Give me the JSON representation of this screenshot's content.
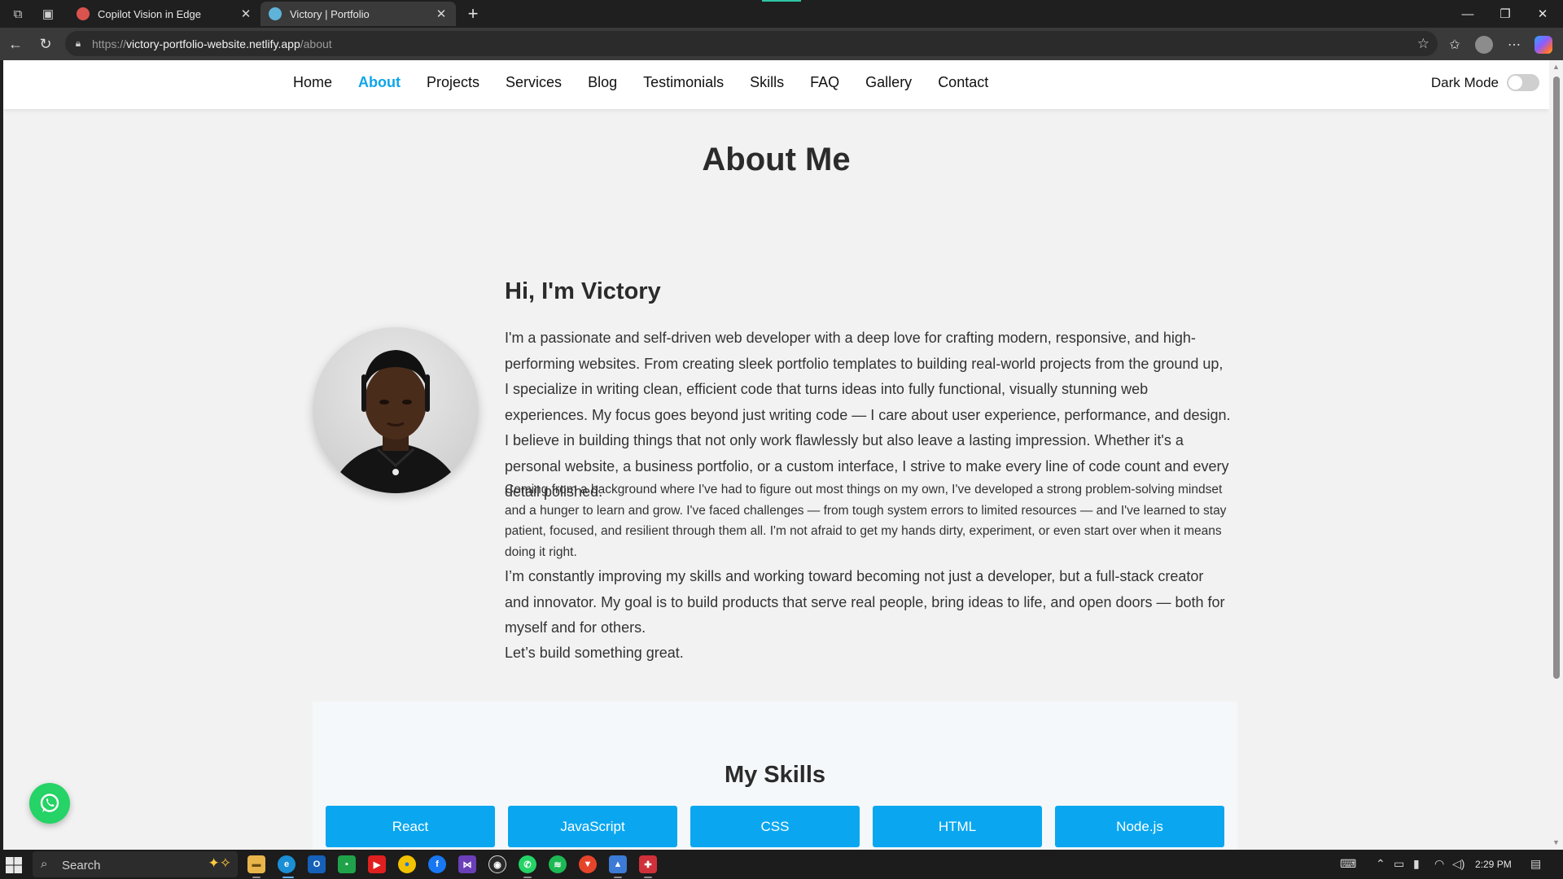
{
  "browser": {
    "tabs": [
      {
        "title": "Copilot Vision in Edge",
        "favicon_color": "#d9534f"
      },
      {
        "title": "Victory | Portfolio",
        "favicon_color": "#5fb3d9"
      }
    ],
    "url_prefix": "https://",
    "url_host": "victory-portfolio-website.netlify.app",
    "url_path": "/about"
  },
  "navbar": {
    "links": [
      "Home",
      "About",
      "Projects",
      "Services",
      "Blog",
      "Testimonials",
      "Skills",
      "FAQ",
      "Gallery",
      "Contact"
    ],
    "active": "About",
    "dark_mode_label": "Dark Mode",
    "dark_mode_on": false,
    "accent_color": "#0ea5ea"
  },
  "about": {
    "title": "About Me",
    "heading": "Hi, I'm Victory",
    "paragraphs": [
      "I'm a passionate and self-driven web developer with a deep love for crafting modern, responsive, and high-performing websites. From creating sleek portfolio templates to building real-world projects from the ground up, I specialize in writing clean, efficient code that turns ideas into fully functional, visually stunning web experiences. My focus goes beyond just writing code — I care about user experience, performance, and design. I believe in building things that not only work flawlessly but also leave a lasting impression. Whether it's a personal website, a business portfolio, or a custom interface, I strive to make every line of code count and every detail polished.",
      "Coming from a background where I've had to figure out most things on my own, I've developed a strong problem-solving mindset and a hunger to learn and grow. I've faced challenges — from tough system errors to limited resources — and I've learned to stay patient, focused, and resilient through them all. I'm not afraid to get my hands dirty, experiment, or even start over when it means doing it right.",
      "I’m constantly improving my skills and working toward becoming not just a developer, but a full-stack creator and innovator. My goal is to build products that serve real people, bring ideas to life, and open doors — both for myself and for others.",
      "Let’s build something great."
    ]
  },
  "skills": {
    "title": "My Skills",
    "items": [
      "React",
      "JavaScript",
      "CSS",
      "HTML",
      "Node.js"
    ],
    "button_color": "#0aa7f0"
  },
  "taskbar": {
    "search_placeholder": "Search",
    "time": "2:29 PM"
  }
}
